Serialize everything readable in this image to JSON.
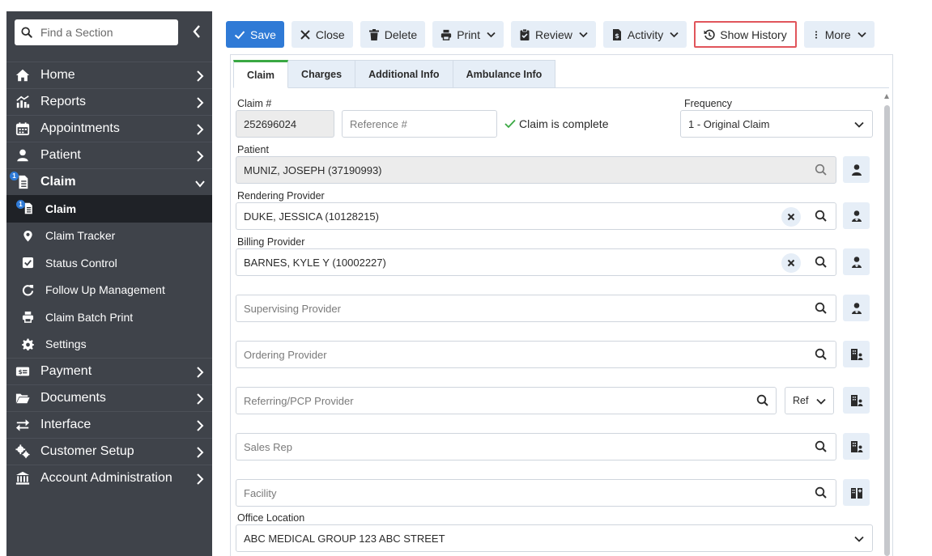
{
  "sidebar": {
    "search_placeholder": "Find a Section",
    "items": [
      {
        "label": "Home",
        "icon": "home-icon"
      },
      {
        "label": "Reports",
        "icon": "reports-icon"
      },
      {
        "label": "Appointments",
        "icon": "calendar-icon"
      },
      {
        "label": "Patient",
        "icon": "user-icon"
      },
      {
        "label": "Claim",
        "icon": "claim-icon",
        "badge": "1",
        "expanded": true
      },
      {
        "label": "Payment",
        "icon": "payment-icon"
      },
      {
        "label": "Documents",
        "icon": "folder-icon"
      },
      {
        "label": "Interface",
        "icon": "exchange-icon"
      },
      {
        "label": "Customer Setup",
        "icon": "gears-icon"
      },
      {
        "label": "Account Administration",
        "icon": "bank-icon"
      }
    ],
    "claim_sub": [
      {
        "label": "Claim",
        "icon": "claim-icon",
        "badge": "1",
        "active": true
      },
      {
        "label": "Claim Tracker",
        "icon": "map-marker-icon"
      },
      {
        "label": "Status Control",
        "icon": "checkbox-icon"
      },
      {
        "label": "Follow Up Management",
        "icon": "refresh-icon"
      },
      {
        "label": "Claim Batch Print",
        "icon": "print-icon"
      },
      {
        "label": "Settings",
        "icon": "gear-icon"
      }
    ]
  },
  "toolbar": {
    "save": "Save",
    "close": "Close",
    "delete": "Delete",
    "print": "Print",
    "review": "Review",
    "activity": "Activity",
    "show_history": "Show History",
    "more": "More"
  },
  "tabs": [
    "Claim",
    "Charges",
    "Additional Info",
    "Ambulance Info"
  ],
  "form": {
    "claim_label": "Claim #",
    "claim_value": "252696024",
    "reference_placeholder": "Reference #",
    "complete_text": "Claim is complete",
    "frequency_label": "Frequency",
    "frequency_value": "1 - Original Claim",
    "patient_label": "Patient",
    "patient_value": "MUNIZ, JOSEPH (37190993)",
    "rendering_label": "Rendering Provider",
    "rendering_value": "DUKE, JESSICA (10128215)",
    "billing_label": "Billing Provider",
    "billing_value": "BARNES, KYLE Y (10002227)",
    "supervising_placeholder": "Supervising Provider",
    "ordering_placeholder": "Ordering Provider",
    "referring_placeholder": "Referring/PCP Provider",
    "ref_select": "Ref",
    "sales_placeholder": "Sales Rep",
    "facility_placeholder": "Facility",
    "office_label": "Office Location",
    "office_value": "ABC MEDICAL GROUP 123 ABC STREET"
  },
  "colors": {
    "sidebar_bg": "#3f434a",
    "active_bg": "#1f2227",
    "accent_blue": "#2f7ad6",
    "button_bg": "#e6eef7",
    "highlight_border": "#e1555b",
    "success_green": "#3aa843"
  }
}
